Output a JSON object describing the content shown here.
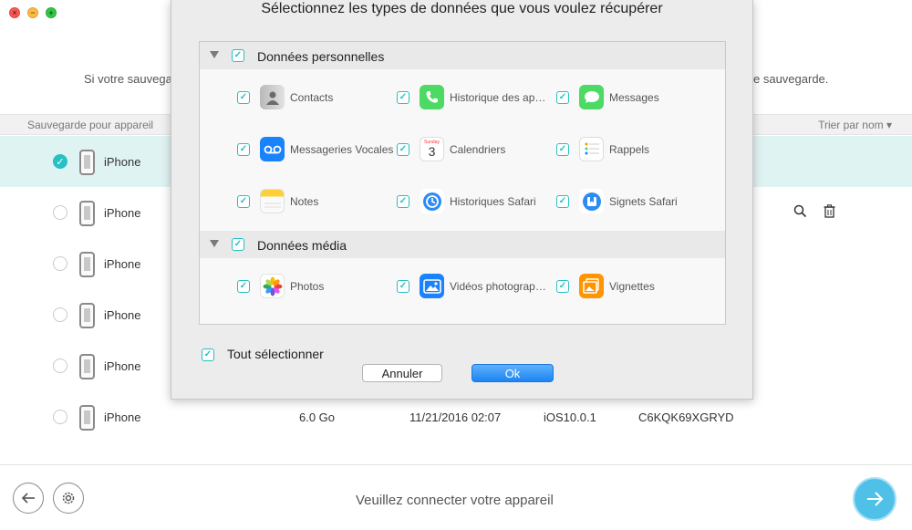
{
  "window": {
    "info_left": "Si votre sauvega",
    "info_right": "e sauvegarde."
  },
  "list": {
    "header_left": "Sauvegarde pour appareil",
    "header_right": "Trier par nom ▾",
    "rows": [
      {
        "name": "iPhone",
        "selected": true
      },
      {
        "name": "iPhone"
      },
      {
        "name": "iPhone"
      },
      {
        "name": "iPhone"
      },
      {
        "name": "iPhone"
      },
      {
        "name": "iPhone",
        "size": "6.0 Go",
        "date": "11/21/2016 02:07",
        "ios": "iOS10.0.1",
        "serial": "C6KQK69XGRYD"
      }
    ]
  },
  "bottom": {
    "status": "Veuillez connecter votre appareil"
  },
  "dialog": {
    "title": "Sélectionnez les types de données que vous voulez récupérer",
    "personal_title": "Données personnelles",
    "media_title": "Données média",
    "items": {
      "contacts": "Contacts",
      "calls": "Historique des ap…",
      "messages": "Messages",
      "voicemail": "Messageries Vocales",
      "calendars": "Calendriers",
      "reminders": "Rappels",
      "notes": "Notes",
      "safari_history": "Historiques Safari",
      "safari_bookmarks": "Signets Safari",
      "photos": "Photos",
      "videos": "Vidéos photograp…",
      "thumbnails": "Vignettes",
      "calendar_day": "3",
      "calendar_weekday": "Sunday"
    },
    "select_all": "Tout sélectionner",
    "cancel": "Annuler",
    "ok": "Ok"
  },
  "colors": {
    "accent": "#27bfc3",
    "selected_row": "#e0f3f3",
    "ok_button": "#1d84f3"
  }
}
